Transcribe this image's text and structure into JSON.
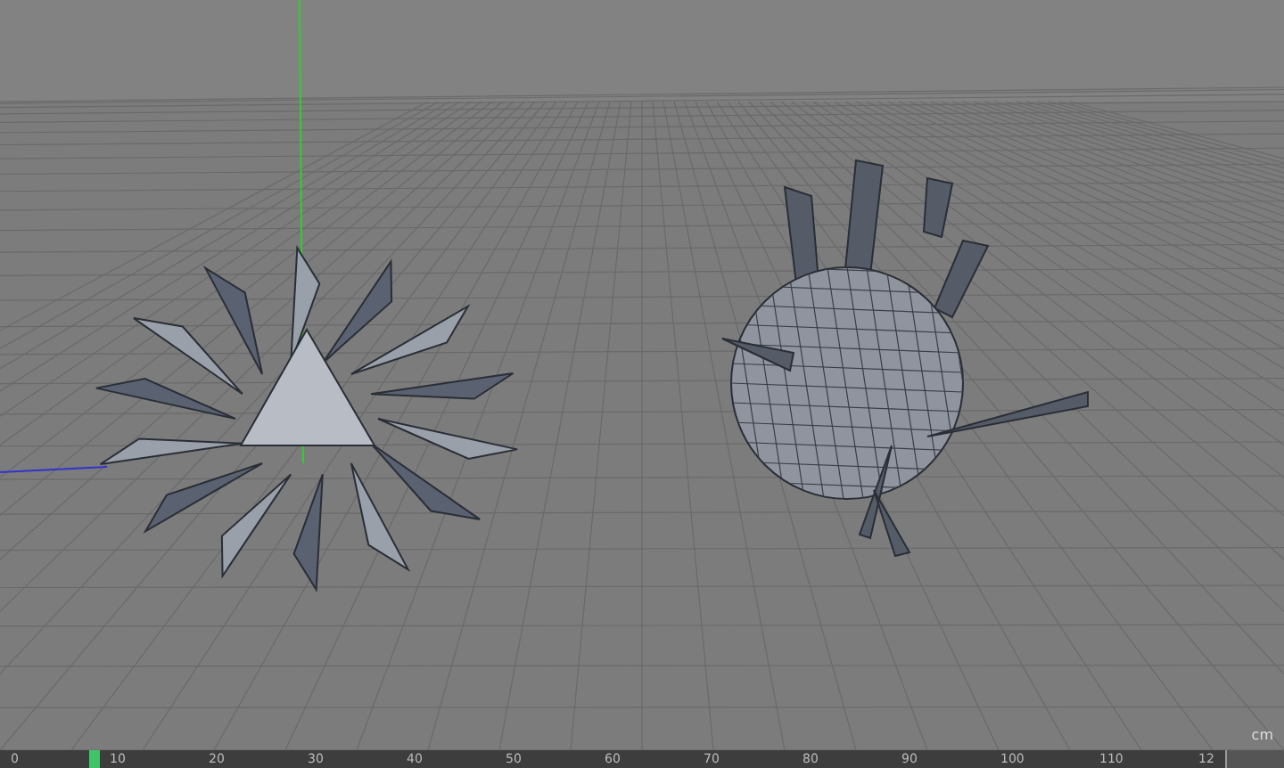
{
  "viewport": {
    "grid_unit": "cm"
  },
  "timeline": {
    "ticks": [
      "0",
      "10",
      "20",
      "30",
      "40",
      "50",
      "60",
      "70",
      "80",
      "90",
      "100",
      "110",
      "12"
    ],
    "playhead": {
      "level": 0.06
    }
  }
}
